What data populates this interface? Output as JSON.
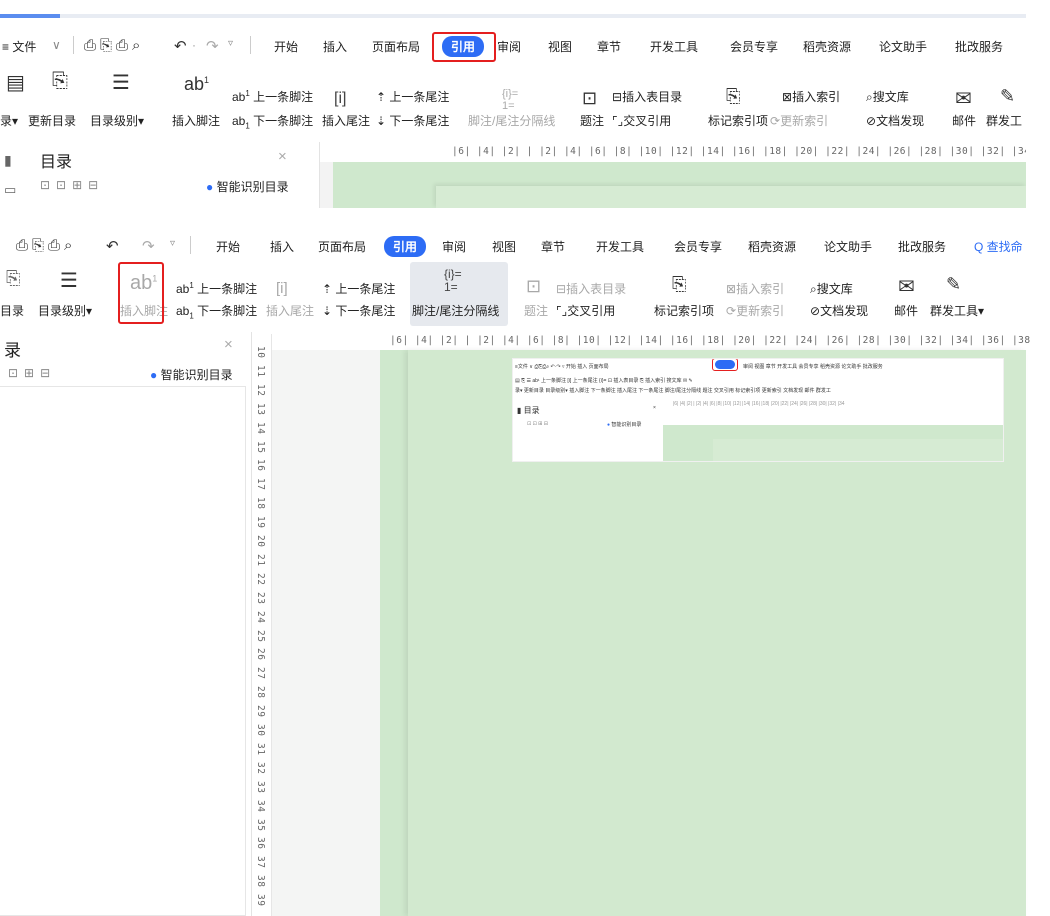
{
  "top": {
    "menu_prefix": "≡ 文件",
    "tabs": [
      "开始",
      "插入",
      "页面布局",
      "引用",
      "审阅",
      "视图",
      "章节",
      "开发工具",
      "会员专享",
      "稻壳资源",
      "论文助手",
      "批改服务"
    ],
    "active_tab": "引用",
    "ribbon": {
      "toc_label": "录",
      "update_toc": "更新目录",
      "toc_level": "目录级别",
      "insert_footnote": "插入脚注",
      "prev_footnote": "上一条脚注",
      "next_footnote": "下一条脚注",
      "insert_endnote": "插入尾注",
      "prev_endnote": "上一条尾注",
      "next_endnote": "下一条尾注",
      "separator": "脚注/尾注分隔线",
      "caption": "题注",
      "insert_table_toc": "插入表目录",
      "cross_ref": "交叉引用",
      "mark_index": "标记索引项",
      "insert_index": "插入索引",
      "update_index": "更新索引",
      "search_lib": "搜文库",
      "doc_discover": "文档发现",
      "mail": "邮件",
      "mass_tool": "群发工"
    },
    "pane_title": "目录",
    "smart_toc": "智能识别目录",
    "ruler": "|6| |4| |2| |  |2| |4| |6| |8| |10| |12| |14| |16| |18| |20| |22| |24| |26| |28| |30| |32| |34"
  },
  "bottom": {
    "tabs": [
      "开始",
      "插入",
      "页面布局",
      "引用",
      "审阅",
      "视图",
      "章节",
      "开发工具",
      "会员专享",
      "稻壳资源",
      "论文助手",
      "批改服务"
    ],
    "active_tab": "引用",
    "search": "Q 查找命",
    "ribbon": {
      "toc": "目录",
      "toc_level": "目录级别",
      "insert_footnote": "插入脚注",
      "prev_footnote": "上一条脚注",
      "next_footnote": "下一条脚注",
      "prev_endnote": "上一条尾注",
      "insert_endnote": "插入尾注",
      "next_endnote": "下一条尾注",
      "separator": "脚注/尾注分隔线",
      "caption": "题注",
      "insert_table_toc": "插入表目录",
      "cross_ref": "交叉引用",
      "mark_index": "标记索引项",
      "insert_index": "插入索引",
      "update_index": "更新索引",
      "search_lib": "搜文库",
      "doc_discover": "文档发现",
      "mail": "邮件",
      "mass_tool": "群发工具"
    },
    "pane_title": "录",
    "smart_toc": "智能识别目录",
    "ruler": "|6| |4| |2| |  |2| |4| |6| |8| |10| |12| |14| |16| |18| |20| |22| |24| |26| |28| |30| |32| |34| |36| |38",
    "vruler": [
      "10",
      "11",
      "12",
      "13",
      "14",
      "15",
      "16",
      "17",
      "18",
      "19",
      "20",
      "21",
      "22",
      "23",
      "24",
      "25",
      "26",
      "27",
      "28",
      "29",
      "30",
      "31",
      "32",
      "33",
      "34",
      "35",
      "36",
      "37",
      "38",
      "39"
    ]
  },
  "colors": {
    "accent": "#2d6cf5",
    "highlight": "#e41f1f",
    "doc_bg": "#cfe8cd"
  }
}
